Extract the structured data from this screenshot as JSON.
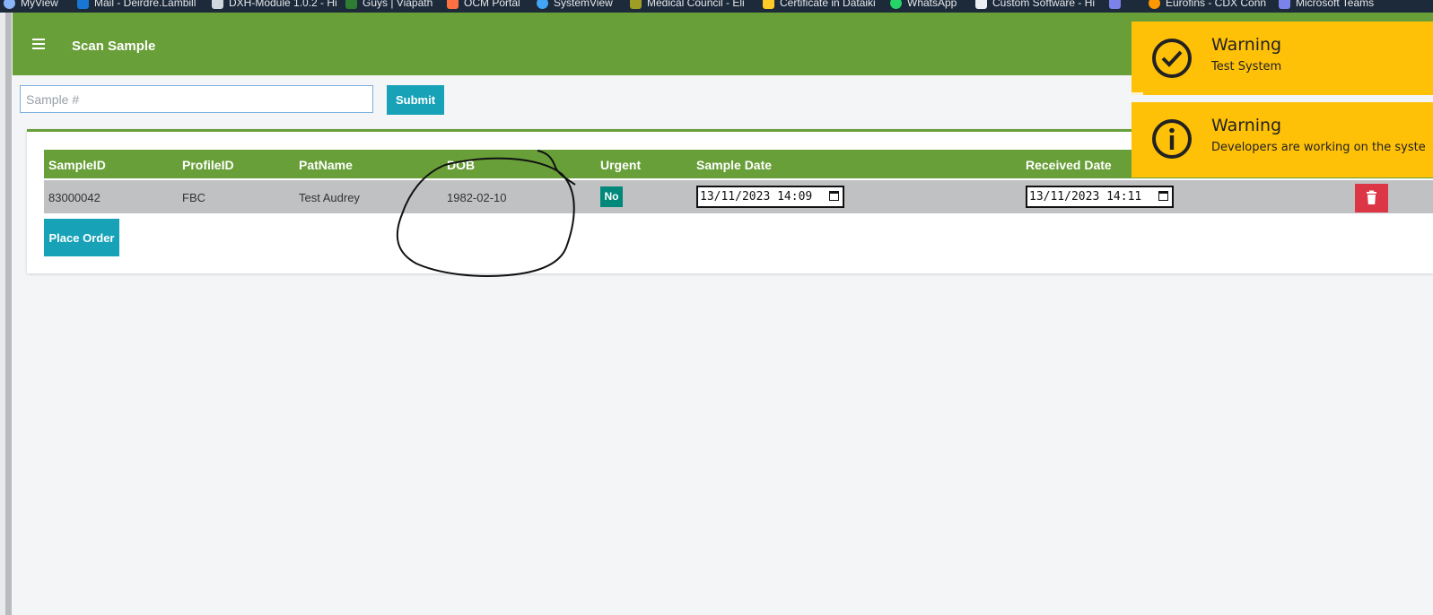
{
  "bookmarks": [
    {
      "label": "MyView",
      "icon": "refresh-icon",
      "color": "#8ab4f8"
    },
    {
      "label": "Mail - Deirdre.Lambill",
      "icon": "outlook-icon",
      "color": "#1976d2"
    },
    {
      "label": "DXH-Module 1.0.2 - Hi",
      "icon": "chart-icon",
      "color": "#cfd8dc"
    },
    {
      "label": "Guys | Viapath",
      "icon": "viapath-icon",
      "color": "#2e7d32"
    },
    {
      "label": "OCM Portal",
      "icon": "portal-icon",
      "color": "#ff7043"
    },
    {
      "label": "SystemView",
      "icon": "globe-icon",
      "color": "#42a5f5"
    },
    {
      "label": "Medical Council - Eli",
      "icon": "shield-icon",
      "color": "#9e9d24"
    },
    {
      "label": "Certificate in Dataiki",
      "icon": "certificate-icon",
      "color": "#ffca28"
    },
    {
      "label": "WhatsApp",
      "icon": "whatsapp-icon",
      "color": "#25d366"
    },
    {
      "label": "Custom Software - Hi",
      "icon": "document-icon",
      "color": "#eceff1"
    },
    {
      "label": "",
      "icon": "teams-icon",
      "color": "#7b83eb"
    },
    {
      "label": "Eurofins - CDX Conn",
      "icon": "eurofins-icon",
      "color": "#ff9800"
    },
    {
      "label": "Microsoft Teams",
      "icon": "teams-icon",
      "color": "#7b83eb"
    }
  ],
  "header": {
    "title": "Scan Sample",
    "color": "#689f38"
  },
  "search": {
    "placeholder": "Sample #",
    "value": "",
    "submit_label": "Submit"
  },
  "table": {
    "columns": [
      "SampleID",
      "ProfileID",
      "PatName",
      "DOB",
      "Urgent",
      "Sample Date",
      "Received Date"
    ],
    "rows": [
      {
        "sample_id": "83000042",
        "profile_id": "FBC",
        "pat_name": "Test Audrey",
        "dob": "1982-02-10",
        "urgent": "No",
        "sample_date": "13/11/2023 14:09",
        "received_date": "13/11/2023 14:11"
      }
    ]
  },
  "actions": {
    "place_order_label": "Place Order"
  },
  "toasts": [
    {
      "title": "Warning",
      "message": "Test System",
      "icon": "check-circle-icon",
      "color": "#ffc107",
      "progress": 0.04
    },
    {
      "title": "Warning",
      "message": "Developers are working on the syste",
      "icon": "info-circle-icon",
      "color": "#ffc107"
    }
  ],
  "colors": {
    "primary": "#689f38",
    "info": "#17a2b8",
    "danger": "#dc3545",
    "badge": "#00897b",
    "warning": "#ffc107"
  }
}
